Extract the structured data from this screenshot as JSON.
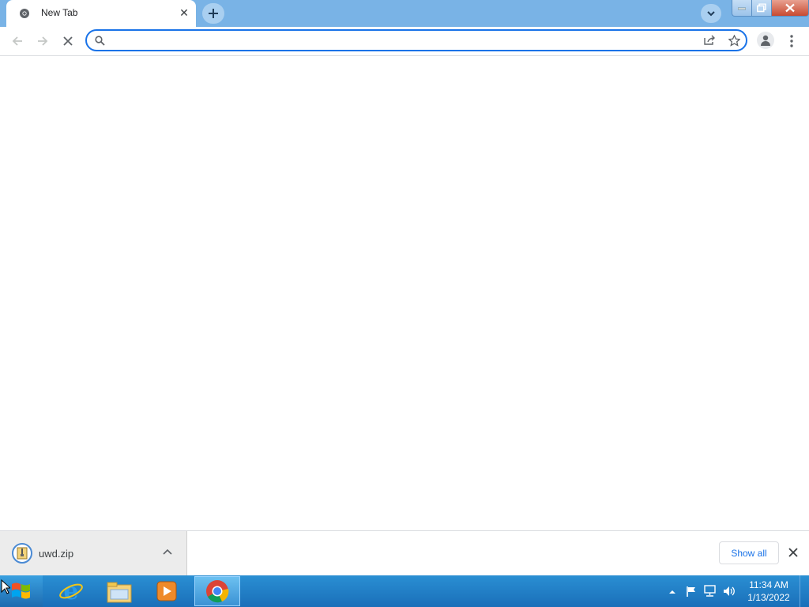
{
  "browser": {
    "tab": {
      "title": "New Tab",
      "close_glyph": "✕"
    },
    "omnibox": {
      "value": "",
      "placeholder": ""
    }
  },
  "download_shelf": {
    "items": [
      {
        "filename": "uwd.zip"
      }
    ],
    "show_all_label": "Show all"
  },
  "taskbar": {
    "time": "11:34 AM",
    "date": "1/13/2022"
  },
  "icons": [
    "chrome-icon",
    "new-tab-icon",
    "tab-search-icon",
    "minimize-icon",
    "maximize-icon",
    "close-window-icon",
    "back-icon",
    "forward-icon",
    "stop-icon",
    "search-icon",
    "share-icon",
    "bookmark-star-icon",
    "profile-icon",
    "menu-icon",
    "zip-file-icon",
    "chevron-up-icon",
    "close-icon",
    "windows-start-icon",
    "internet-explorer-icon",
    "file-explorer-icon",
    "media-player-icon",
    "flag-icon",
    "network-icon",
    "volume-icon"
  ],
  "colors": {
    "accent": "#1a73e8",
    "tabstrip": "#79b3e6",
    "taskbar": "#1f7cc6"
  }
}
